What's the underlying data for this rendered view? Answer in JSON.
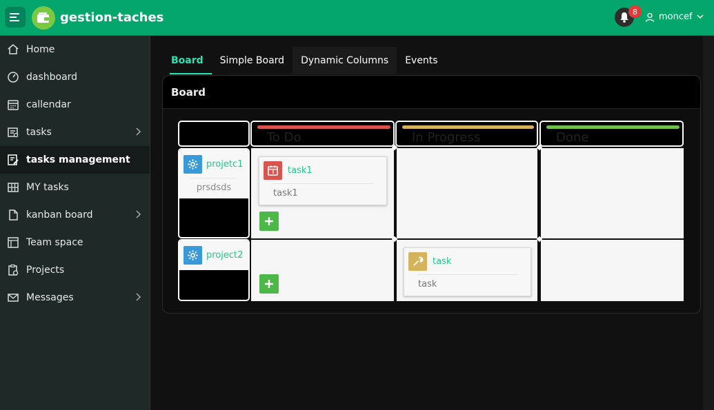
{
  "app": {
    "title": "gestion-taches",
    "notification_count": "8",
    "user_name": "moncef"
  },
  "sidebar": {
    "items": [
      {
        "label": "Home",
        "icon": "home-icon",
        "active": false,
        "has_children": false
      },
      {
        "label": "dashboard",
        "icon": "gauge-icon",
        "active": false,
        "has_children": false
      },
      {
        "label": "callendar",
        "icon": "calendar-icon",
        "active": false,
        "has_children": false
      },
      {
        "label": "tasks",
        "icon": "tasks-icon",
        "active": false,
        "has_children": true
      },
      {
        "label": "tasks management",
        "icon": "edit-list-icon",
        "active": true,
        "has_children": false
      },
      {
        "label": "MY tasks",
        "icon": "grid-icon",
        "active": false,
        "has_children": false
      },
      {
        "label": "kanban board",
        "icon": "file-icon",
        "active": false,
        "has_children": true
      },
      {
        "label": "Team space",
        "icon": "layout-icon",
        "active": false,
        "has_children": false
      },
      {
        "label": "Projects",
        "icon": "clipboard-clock-icon",
        "active": false,
        "has_children": false
      },
      {
        "label": "Messages",
        "icon": "mail-icon",
        "active": false,
        "has_children": true
      }
    ]
  },
  "tabs": [
    {
      "label": "Board",
      "active": true
    },
    {
      "label": "Simple Board",
      "active": false
    },
    {
      "label": "Dynamic Columns",
      "active": false
    },
    {
      "label": "Events",
      "active": false
    }
  ],
  "board": {
    "title": "Board",
    "columns": [
      {
        "title": "To Do",
        "color": "#d9534f"
      },
      {
        "title": "In Progress",
        "color": "#d4b35c"
      },
      {
        "title": "Done",
        "color": "#6fc04a"
      }
    ],
    "rows": [
      {
        "project": "projetc1",
        "description": "prsdsds",
        "icon_color": "#3a9ad9",
        "tasks": {
          "todo": {
            "name": "task1",
            "description": "task1",
            "icon": "calendar-icon",
            "icon_color": "#d9534f"
          }
        }
      },
      {
        "project": "project2",
        "description": "",
        "icon_color": "#3a9ad9",
        "tasks": {
          "progress": {
            "name": "task",
            "description": "task",
            "icon": "wrench-icon",
            "icon_color": "#d4b35c"
          }
        }
      }
    ]
  },
  "colors": {
    "accent": "#05a66b",
    "tab_active": "#1de9b6",
    "link": "#1ecb8a",
    "add_button": "#4cb848"
  }
}
